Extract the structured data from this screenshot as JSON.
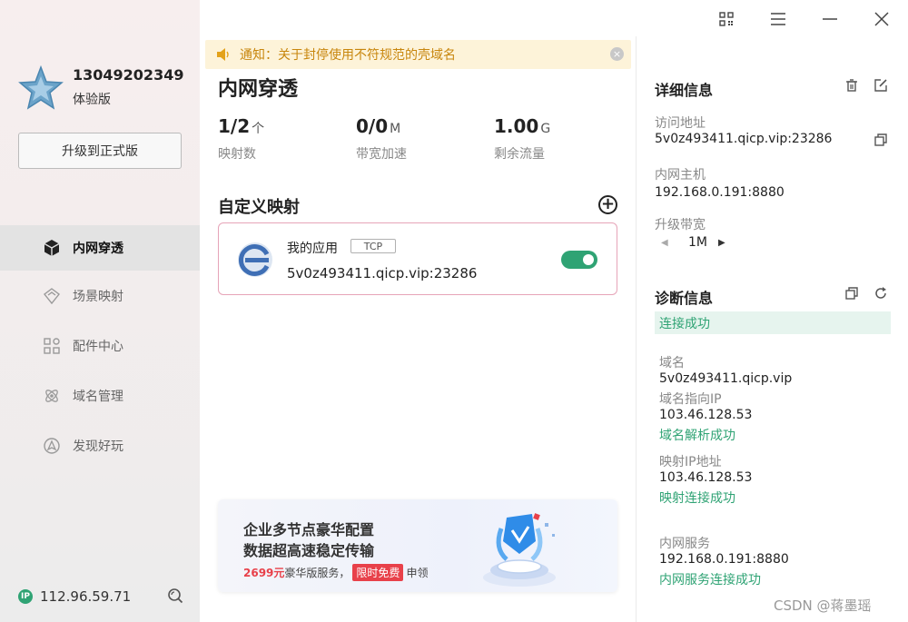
{
  "user": {
    "phone": "13049202349",
    "edition": "体验版",
    "upgrade_label": "升级到正式版"
  },
  "nav": [
    {
      "label": "内网穿透",
      "icon": "cube-icon",
      "active": true
    },
    {
      "label": "场景映射",
      "icon": "scene-icon"
    },
    {
      "label": "配件中心",
      "icon": "grid-icon"
    },
    {
      "label": "域名管理",
      "icon": "atom-icon"
    },
    {
      "label": "发现好玩",
      "icon": "compass-icon"
    }
  ],
  "footer": {
    "ip": "112.96.59.71",
    "ip_badge": "IP"
  },
  "notice": {
    "text": "通知：关于封停使用不符规范的壳域名"
  },
  "main": {
    "title": "内网穿透",
    "stats": [
      {
        "value": "1/2",
        "unit": "个",
        "label": "映射数"
      },
      {
        "value": "0/0",
        "unit": "M",
        "label": "带宽加速"
      },
      {
        "value": "1.00",
        "unit": "G",
        "label": "剩余流量"
      }
    ],
    "section_title": "自定义映射",
    "add_label": "+",
    "mapping": {
      "name": "我的应用",
      "protocol": "TCP",
      "domain": "5v0z493411.qicp.vip:23286",
      "enabled": true
    }
  },
  "promo": {
    "line1": "企业多节点豪华配置",
    "line2": "数据超高速稳定传输",
    "price": "2699元",
    "mid": "豪华版服务，",
    "tag": "限时免费",
    "tail": "申领"
  },
  "details": {
    "title": "详细信息",
    "access_label": "访问地址",
    "access_value": "5v0z493411.qicp.vip:23286",
    "host_label": "内网主机",
    "host_value": "192.168.0.191:8880",
    "bandwidth_label": "升级带宽",
    "bandwidth_value": "1M"
  },
  "diagnosis": {
    "title": "诊断信息",
    "status": "连接成功",
    "domain_label": "域名",
    "domain_value": "5v0z493411.qicp.vip",
    "domain_ip_label": "域名指向IP",
    "domain_ip_value": "103.46.128.53",
    "domain_ok": "域名解析成功",
    "map_ip_label": "映射IP地址",
    "map_ip_value": "103.46.128.53",
    "map_ok": "映射连接成功",
    "service_label": "内网服务",
    "service_value": "192.168.0.191:8880",
    "service_ok": "内网服务连接成功"
  },
  "watermark": "CSDN @蒋墨瑶",
  "colors": {
    "accent_green": "#2fa374",
    "notice_bg": "#fdf3d9",
    "notice_text": "#c8860d",
    "promo_red": "#e8414a"
  }
}
